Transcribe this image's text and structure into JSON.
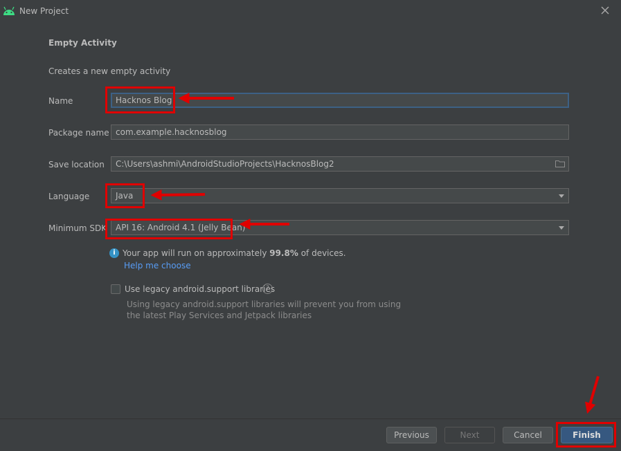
{
  "window": {
    "title": "New Project"
  },
  "form": {
    "heading": "Empty Activity",
    "description": "Creates a new empty activity",
    "name": {
      "label": "Name",
      "value": "Hacknos Blog"
    },
    "package": {
      "label": "Package name",
      "value": "com.example.hacknosblog"
    },
    "save_location": {
      "label": "Save location",
      "value": "C:\\Users\\ashmi\\AndroidStudioProjects\\HacknosBlog2"
    },
    "language": {
      "label": "Language",
      "value": "Java"
    },
    "min_sdk": {
      "label": "Minimum SDK",
      "value": "API 16: Android 4.1 (Jelly Bean)"
    },
    "info": {
      "prefix": "Your app will run on approximately ",
      "percent": "99.8%",
      "suffix": " of devices."
    },
    "help_link": "Help me choose",
    "legacy": {
      "label": "Use legacy android.support libraries",
      "checked": false,
      "note_line1": "Using legacy android.support libraries will prevent you from using",
      "note_line2": "the latest Play Services and Jetpack libraries"
    }
  },
  "buttons": {
    "previous": "Previous",
    "next": "Next",
    "cancel": "Cancel",
    "finish": "Finish"
  },
  "icons": {
    "app": "android-icon",
    "close": "close-icon",
    "folder": "folder-icon",
    "info": "info-icon",
    "help": "question-icon"
  },
  "colors": {
    "background": "#3c3f41",
    "field": "#45494a",
    "focus": "#3d6185",
    "link": "#589df6",
    "primary": "#365880",
    "annotation": "#e00000"
  }
}
